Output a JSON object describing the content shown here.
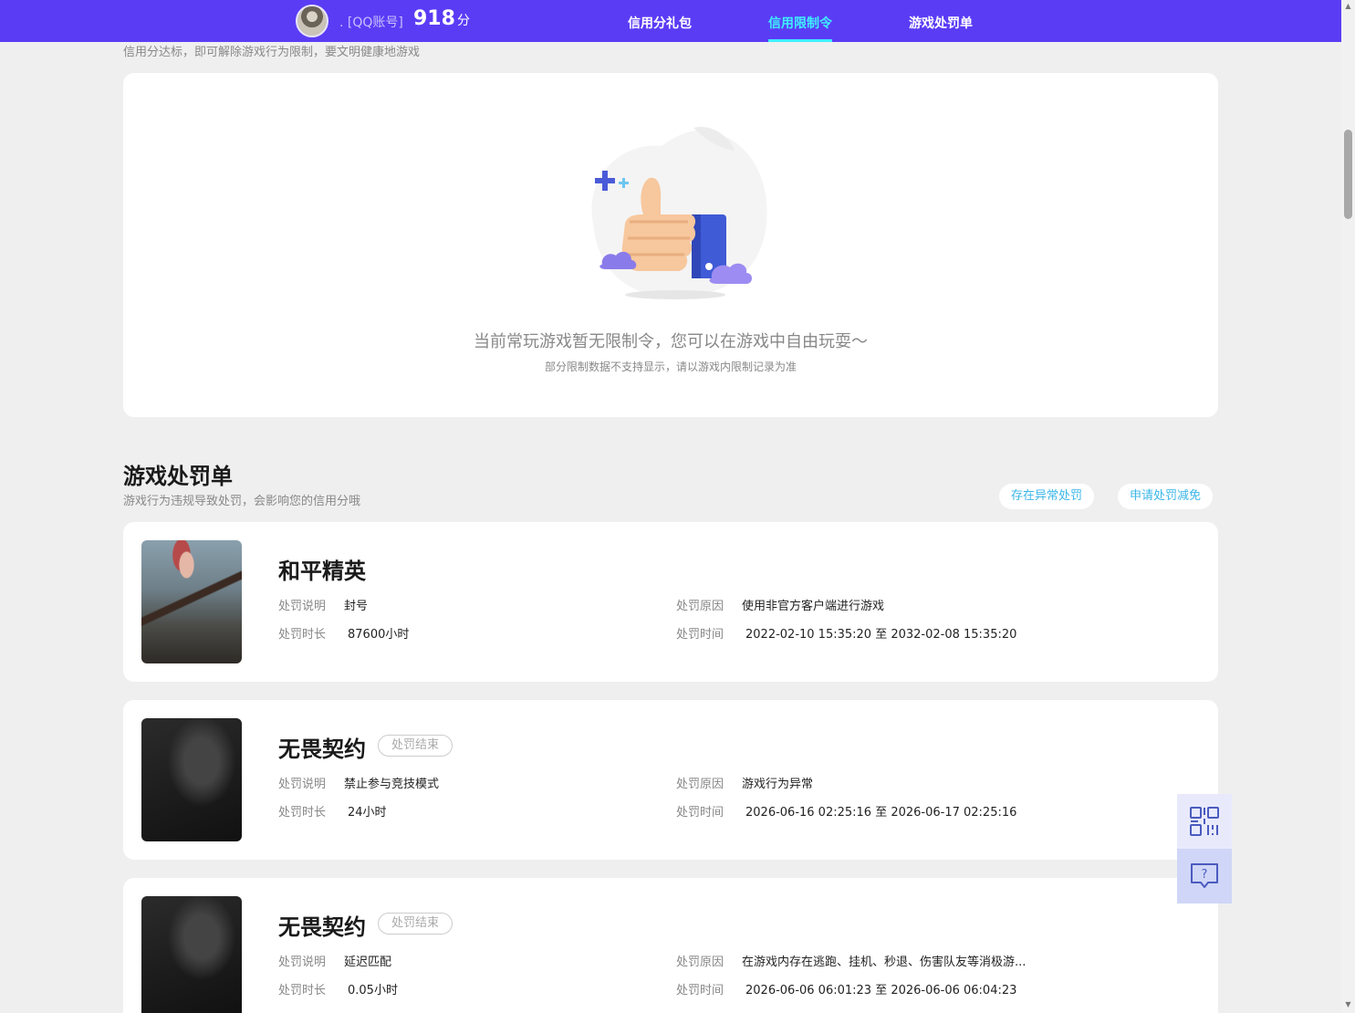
{
  "header": {
    "account_label": ". [QQ账号]",
    "score_value": "918",
    "score_unit": "分",
    "nav": [
      {
        "label": "信用分礼包",
        "active": false
      },
      {
        "label": "信用限制令",
        "active": true
      },
      {
        "label": "游戏处罚单",
        "active": false
      }
    ]
  },
  "restriction": {
    "subtitle": "信用分达标，即可解除游戏行为限制，要文明健康地游戏",
    "empty_message": "当前常玩游戏暂无限制令，您可以在游戏中自由玩耍～",
    "empty_note": "部分限制数据不支持显示，请以游戏内限制记录为准"
  },
  "penalty_section": {
    "title": "游戏处罚单",
    "subtitle": "游戏行为违规导致处罚，会影响您的信用分哦",
    "buttons": [
      "存在异常处罚",
      "申请处罚减免"
    ]
  },
  "labels": {
    "desc": "处罚说明",
    "reason": "处罚原因",
    "duration": "处罚时长",
    "time": "处罚时间"
  },
  "penalties": [
    {
      "game": "和平精英",
      "tag": "",
      "desc": "封号",
      "reason": "使用非官方客户端进行游戏",
      "duration": "87600小时",
      "time": "2022-02-10 15:35:20 至 2032-02-08 15:35:20"
    },
    {
      "game": "无畏契约",
      "tag": "处罚结束",
      "desc": "禁止参与竞技模式",
      "reason": "游戏行为异常",
      "duration": "24小时",
      "time": "2026-06-16 02:25:16 至 2026-06-17 02:25:16"
    },
    {
      "game": "无畏契约",
      "tag": "处罚结束",
      "desc": "延迟匹配",
      "reason": "在游戏内存在逃跑、挂机、秒退、伤害队友等消极游...",
      "duration": "0.05小时",
      "time": "2026-06-06 06:01:23 至 2026-06-06 06:04:23"
    }
  ],
  "colors": {
    "nav_bg": "#5b3cf5",
    "nav_active": "#3ef0ff",
    "accent_link": "#3bb6e8"
  },
  "icons": {
    "qr": "qr-code-icon",
    "help": "help-chat-icon",
    "illustration": "thumbs-up-illustration"
  }
}
